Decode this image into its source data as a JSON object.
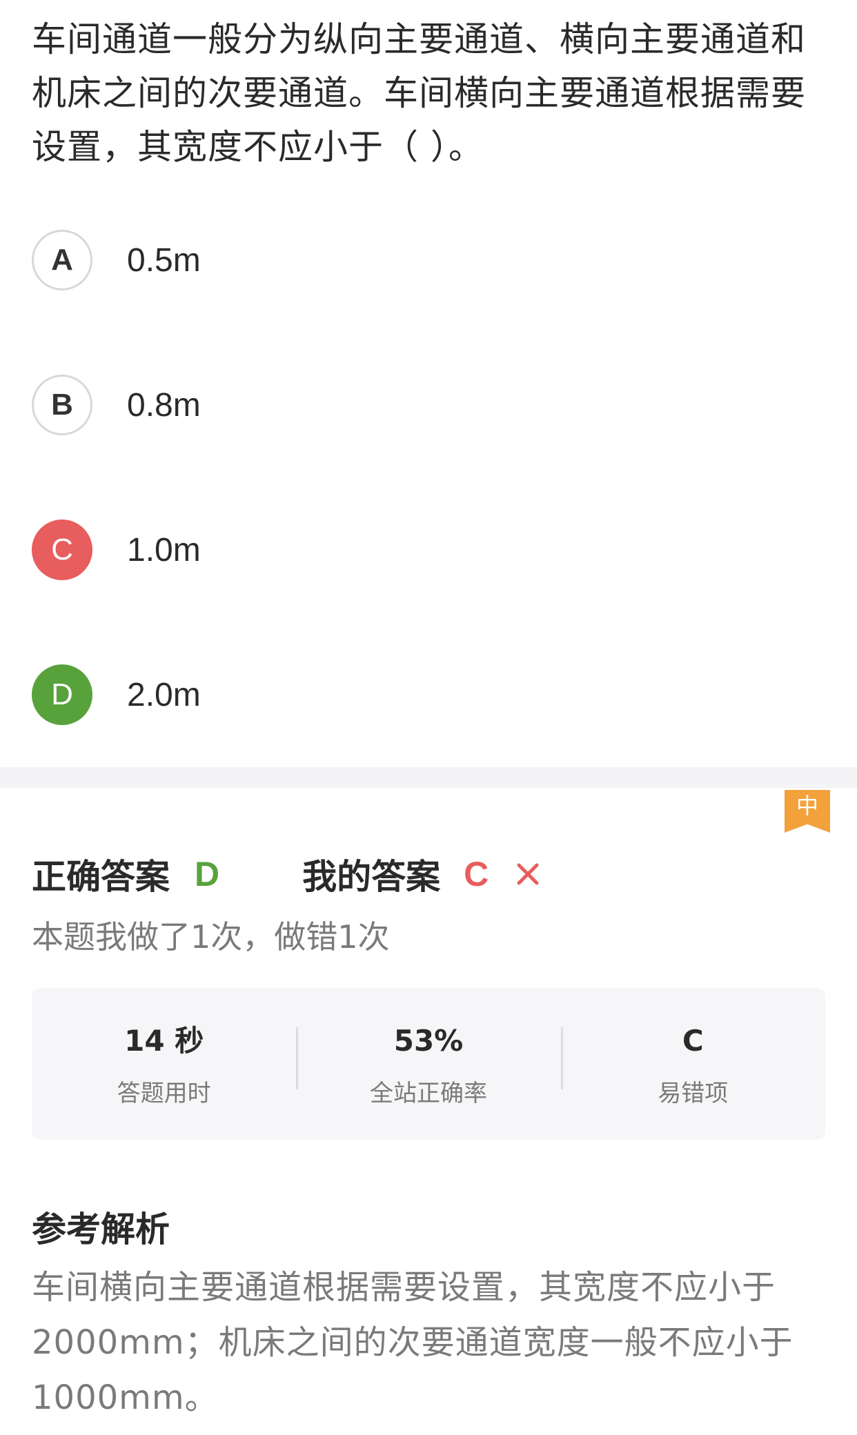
{
  "question": {
    "text": " 车间通道一般分为纵向主要通道、横向主要通道和机床之间的次要通道。车间横向主要通道根据需要设置，其宽度不应小于（    ）。"
  },
  "options": [
    {
      "letter": "A",
      "text": "0.5m",
      "state": "normal"
    },
    {
      "letter": "B",
      "text": "0.8m",
      "state": "normal"
    },
    {
      "letter": "C",
      "text": "1.0m",
      "state": "wrong"
    },
    {
      "letter": "D",
      "text": "2.0m",
      "state": "correct"
    }
  ],
  "difficulty": "中",
  "answer": {
    "correct_label": "正确答案",
    "correct_value": "D",
    "mine_label": "我的答案",
    "mine_value": "C"
  },
  "attempts": "本题我做了1次，做错1次",
  "stats": [
    {
      "value": "14 秒",
      "label": "答题用时"
    },
    {
      "value": "53%",
      "label": "全站正确率"
    },
    {
      "value": "C",
      "label": "易错项"
    }
  ],
  "analysis": {
    "title": "参考解析",
    "text": "车间横向主要通道根据需要设置，其宽度不应小于2000mm；机床之间的次要通道宽度一般不应小于1000mm。"
  },
  "colors": {
    "correct": "#58a23c",
    "wrong": "#e85d5d",
    "difficulty": "#f2a13b"
  },
  "icons": {
    "wrong_mark": "close-icon"
  }
}
